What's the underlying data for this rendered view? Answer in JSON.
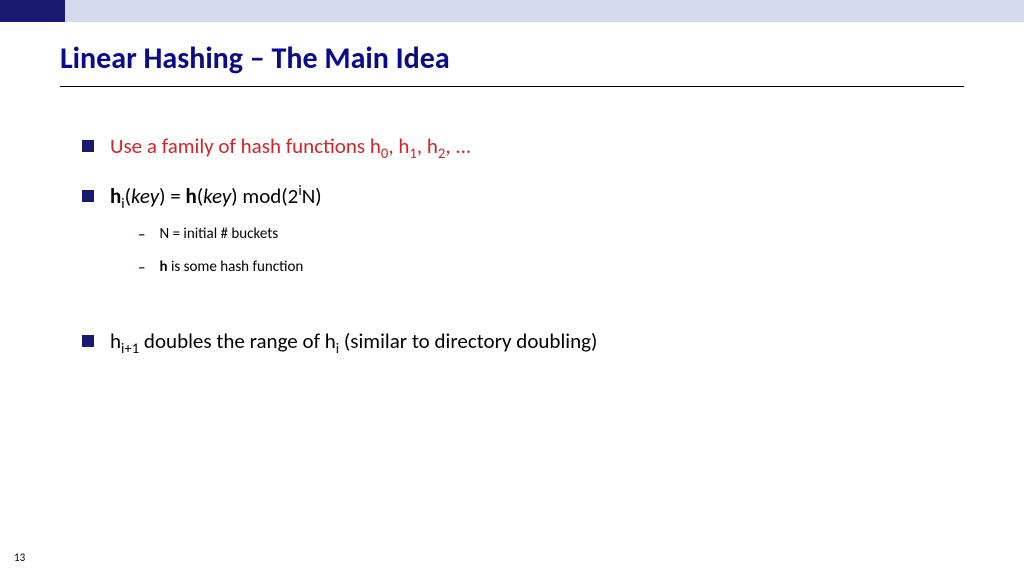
{
  "title": "Linear Hashing – The Main Idea",
  "bullets": {
    "b1_pre": "Use a family of hash functions h",
    "b1_s0": "0",
    "b1_m1": ", h",
    "b1_s1": "1",
    "b1_m2": ", h",
    "b1_s2": "2",
    "b1_m3": ", ...",
    "b2_h": "h",
    "b2_i": "i",
    "b2_p1": "(",
    "b2_key1": "key",
    "b2_p2": ") = ",
    "b2_h2": "h",
    "b2_p3": "(",
    "b2_key2": "key",
    "b2_p4": ") mod(2",
    "b2_sup": "i",
    "b2_p5": "N)",
    "s1": "N = initial # buckets",
    "s2_b": "h",
    "s2_t": " is some hash function",
    "b3_h1": "h",
    "b3_sub1": "i+1",
    "b3_mid": " doubles the range of h",
    "b3_sub2": "i",
    "b3_tail": " (similar to directory doubling)"
  },
  "pageNumber": "13"
}
